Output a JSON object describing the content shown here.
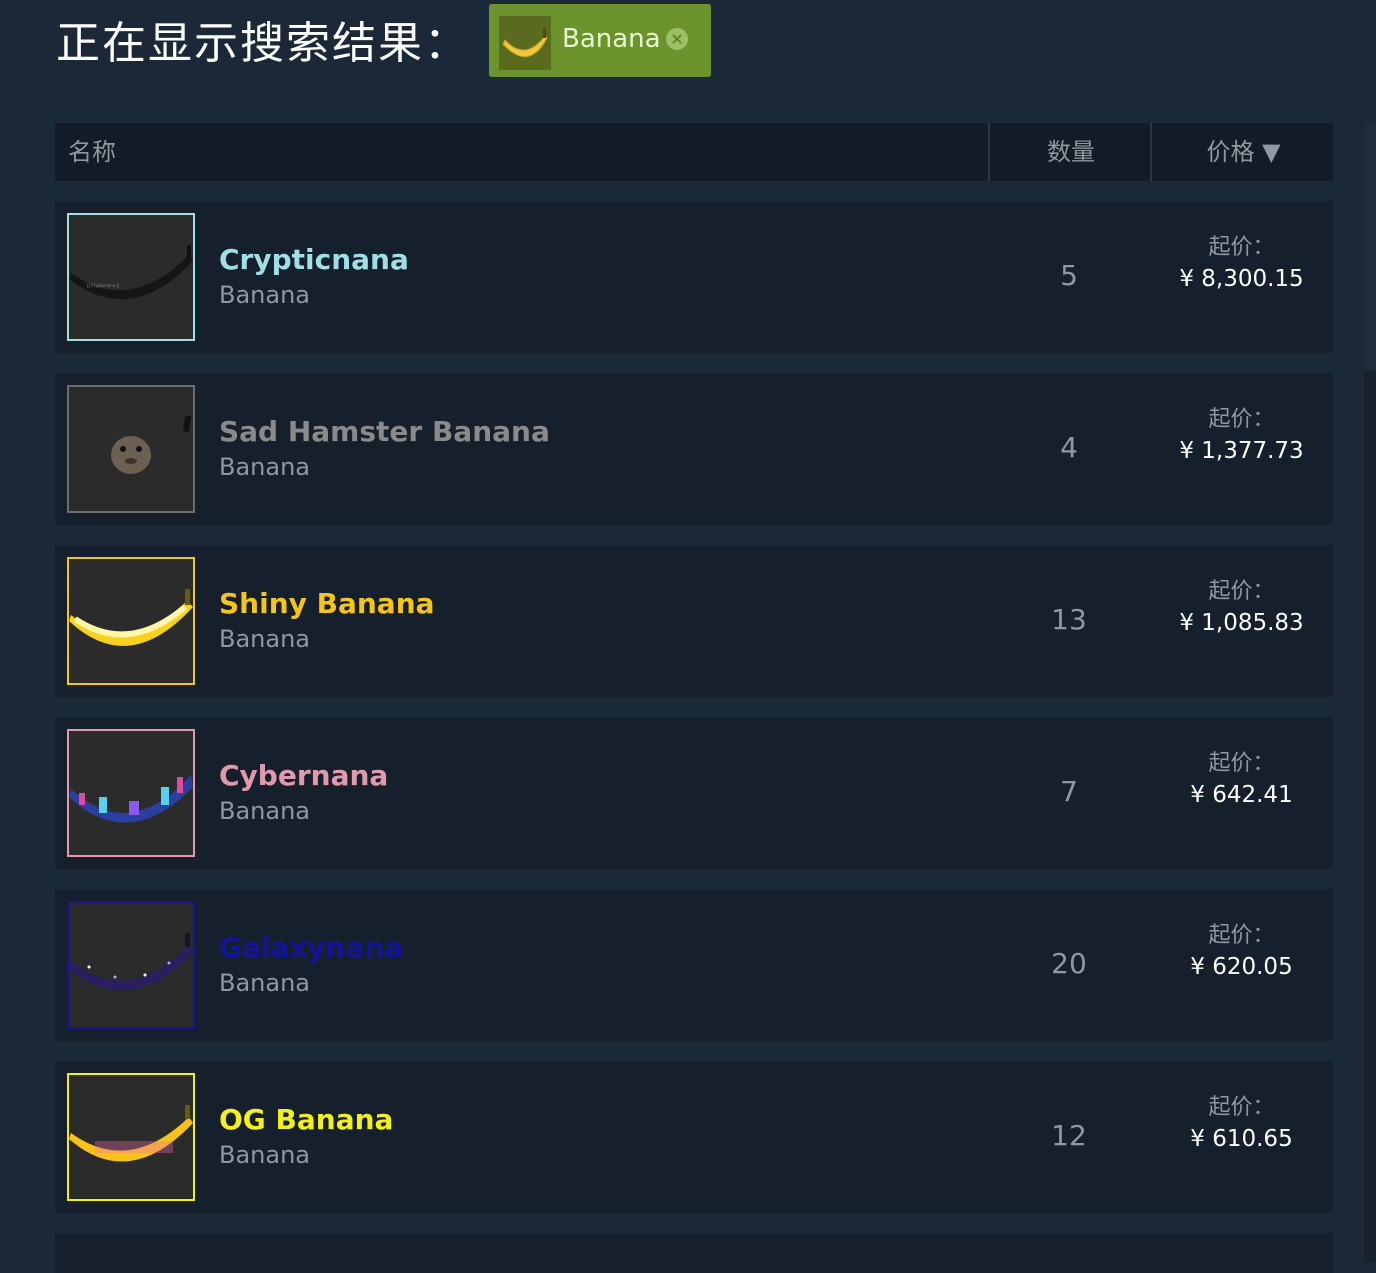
{
  "page": {
    "title": "正在显示搜索结果：",
    "filter": {
      "label": "Banana",
      "close_icon": "×"
    }
  },
  "table": {
    "headers": {
      "name": "名称",
      "quantity": "数量",
      "price": "价格 ▼"
    }
  },
  "rows": [
    {
      "name": "Crypticnana",
      "game": "Banana",
      "quantity": "5",
      "price_label": "起价：",
      "price": "¥ 8,300.15",
      "name_color": "#a0dfe6"
    },
    {
      "name": "Sad Hamster Banana",
      "game": "Banana",
      "quantity": "4",
      "price_label": "起价：",
      "price": "¥ 1,377.73",
      "name_color": "#8a8a8a"
    },
    {
      "name": "Shiny Banana",
      "game": "Banana",
      "quantity": "13",
      "price_label": "起价：",
      "price": "¥ 1,085.83",
      "name_color": "#f5c518"
    },
    {
      "name": "Cybernana",
      "game": "Banana",
      "quantity": "7",
      "price_label": "起价：",
      "price": "¥ 642.41",
      "name_color": "#e09aab"
    },
    {
      "name": "Galaxynana",
      "game": "Banana",
      "quantity": "20",
      "price_label": "起价：",
      "price": "¥ 620.05",
      "name_color": "#141499"
    },
    {
      "name": "OG Banana",
      "game": "Banana",
      "quantity": "12",
      "price_label": "起价：",
      "price": "¥ 610.65",
      "name_color": "#f4f01c"
    }
  ]
}
